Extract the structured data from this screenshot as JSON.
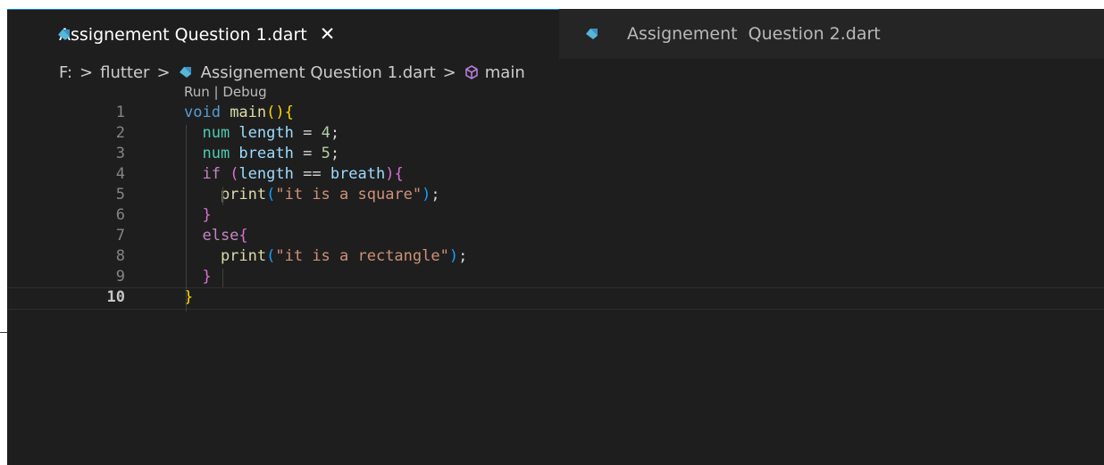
{
  "tabs": [
    {
      "label": "Assignement Question 1.dart",
      "active": true,
      "close": "✕",
      "icon": "dart-icon"
    },
    {
      "label": "Assignement  Question 2.dart",
      "active": false,
      "icon": "dart-icon"
    }
  ],
  "breadcrumb": {
    "drive": "F:",
    "folder": "flutter",
    "file": "Assignement Question 1.dart",
    "symbol": "main",
    "separator": ">"
  },
  "codelens": "Run | Debug",
  "code": {
    "line_numbers": [
      "1",
      "2",
      "3",
      "4",
      "5",
      "6",
      "7",
      "8",
      "9",
      "10"
    ],
    "lines": [
      [
        {
          "t": "void ",
          "c": "kw"
        },
        {
          "t": "main",
          "c": "fn"
        },
        {
          "t": "()",
          "c": "br1"
        },
        {
          "t": "{",
          "c": "br1"
        }
      ],
      [
        {
          "t": "  num ",
          "c": "ty"
        },
        {
          "t": "length",
          "c": "var"
        },
        {
          "t": " = ",
          "c": "op"
        },
        {
          "t": "4",
          "c": "num"
        },
        {
          "t": ";",
          "c": "pun"
        }
      ],
      [
        {
          "t": "  num ",
          "c": "ty"
        },
        {
          "t": "breath",
          "c": "var"
        },
        {
          "t": " = ",
          "c": "op"
        },
        {
          "t": "5",
          "c": "num"
        },
        {
          "t": ";",
          "c": "pun"
        }
      ],
      [
        {
          "t": "  if ",
          "c": "kw2"
        },
        {
          "t": "(",
          "c": "br2"
        },
        {
          "t": "length",
          "c": "var"
        },
        {
          "t": " == ",
          "c": "op"
        },
        {
          "t": "breath",
          "c": "var"
        },
        {
          "t": ")",
          "c": "br2"
        },
        {
          "t": "{",
          "c": "br2"
        }
      ],
      [
        {
          "t": "    print",
          "c": "fn"
        },
        {
          "t": "(",
          "c": "br3"
        },
        {
          "t": "\"it is a square\"",
          "c": "str"
        },
        {
          "t": ")",
          "c": "br3"
        },
        {
          "t": ";",
          "c": "pun"
        }
      ],
      [
        {
          "t": "  }",
          "c": "br2"
        }
      ],
      [
        {
          "t": "  else",
          "c": "kw2"
        },
        {
          "t": "{",
          "c": "br2"
        }
      ],
      [
        {
          "t": "    print",
          "c": "fn"
        },
        {
          "t": "(",
          "c": "br3"
        },
        {
          "t": "\"it is a rectangle\"",
          "c": "str"
        },
        {
          "t": ")",
          "c": "br3"
        },
        {
          "t": ";",
          "c": "pun"
        }
      ],
      [
        {
          "t": "  }",
          "c": "br2"
        }
      ],
      [
        {
          "t": "}",
          "c": "br1"
        }
      ]
    ],
    "current_line": 10
  }
}
